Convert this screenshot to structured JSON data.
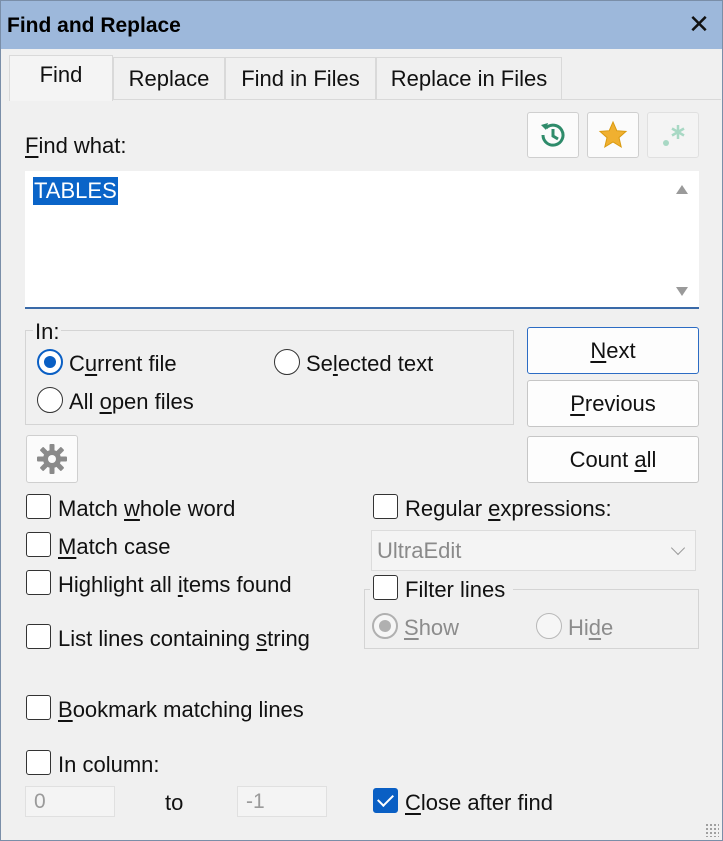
{
  "window": {
    "title": "Find and Replace",
    "close_glyph": "✕"
  },
  "tabs": [
    {
      "label": "Find"
    },
    {
      "label": "Replace"
    },
    {
      "label": "Find in Files"
    },
    {
      "label": "Replace in Files"
    }
  ],
  "find": {
    "label_prefix": "",
    "label_mnemonic": "F",
    "label_rest": "ind what:",
    "value": "TABLES"
  },
  "icons": {
    "history": "history-icon",
    "favorites": "star-icon",
    "regex": "regex-icon",
    "settings": "gear-icon"
  },
  "in_group": {
    "label": "In:",
    "current_file": {
      "pre": "C",
      "mn": "u",
      "post": "rrent file"
    },
    "selected_text": {
      "pre": "Se",
      "mn": "l",
      "post": "ected text"
    },
    "all_open_files": {
      "pre": "All ",
      "mn": "o",
      "post": "pen files"
    }
  },
  "buttons": {
    "next": {
      "pre": "",
      "mn": "N",
      "post": "ext"
    },
    "previous": {
      "pre": "",
      "mn": "P",
      "post": "revious"
    },
    "count_all": {
      "pre": "Count ",
      "mn": "a",
      "post": "ll"
    }
  },
  "options": {
    "match_whole_word": {
      "pre": "Match ",
      "mn": "w",
      "post": "hole word"
    },
    "match_case": {
      "pre": "",
      "mn": "M",
      "post": "atch case"
    },
    "highlight_all": {
      "pre": "Highlight all ",
      "mn": "i",
      "post": "tems found"
    },
    "list_lines": {
      "pre": "List lines containing ",
      "mn": "s",
      "post": "tring"
    },
    "bookmark_lines": {
      "pre": "",
      "mn": "B",
      "post": "ookmark matching lines"
    },
    "in_column": "In column:",
    "regex": {
      "pre": "Regular ",
      "mn": "e",
      "post": "xpressions:"
    },
    "regex_engine": "UltraEdit",
    "filter_lines": "Filter lines",
    "show": {
      "pre": "",
      "mn": "S",
      "post": "how"
    },
    "hide": {
      "pre": "Hi",
      "mn": "d",
      "post": "e"
    },
    "close_after_find": {
      "pre": "",
      "mn": "C",
      "post": "lose after find"
    }
  },
  "column": {
    "from": "0",
    "to_label": "to",
    "to": "-1"
  },
  "colors": {
    "accent": "#0a5fc4",
    "titlebar": "#9db8db"
  }
}
